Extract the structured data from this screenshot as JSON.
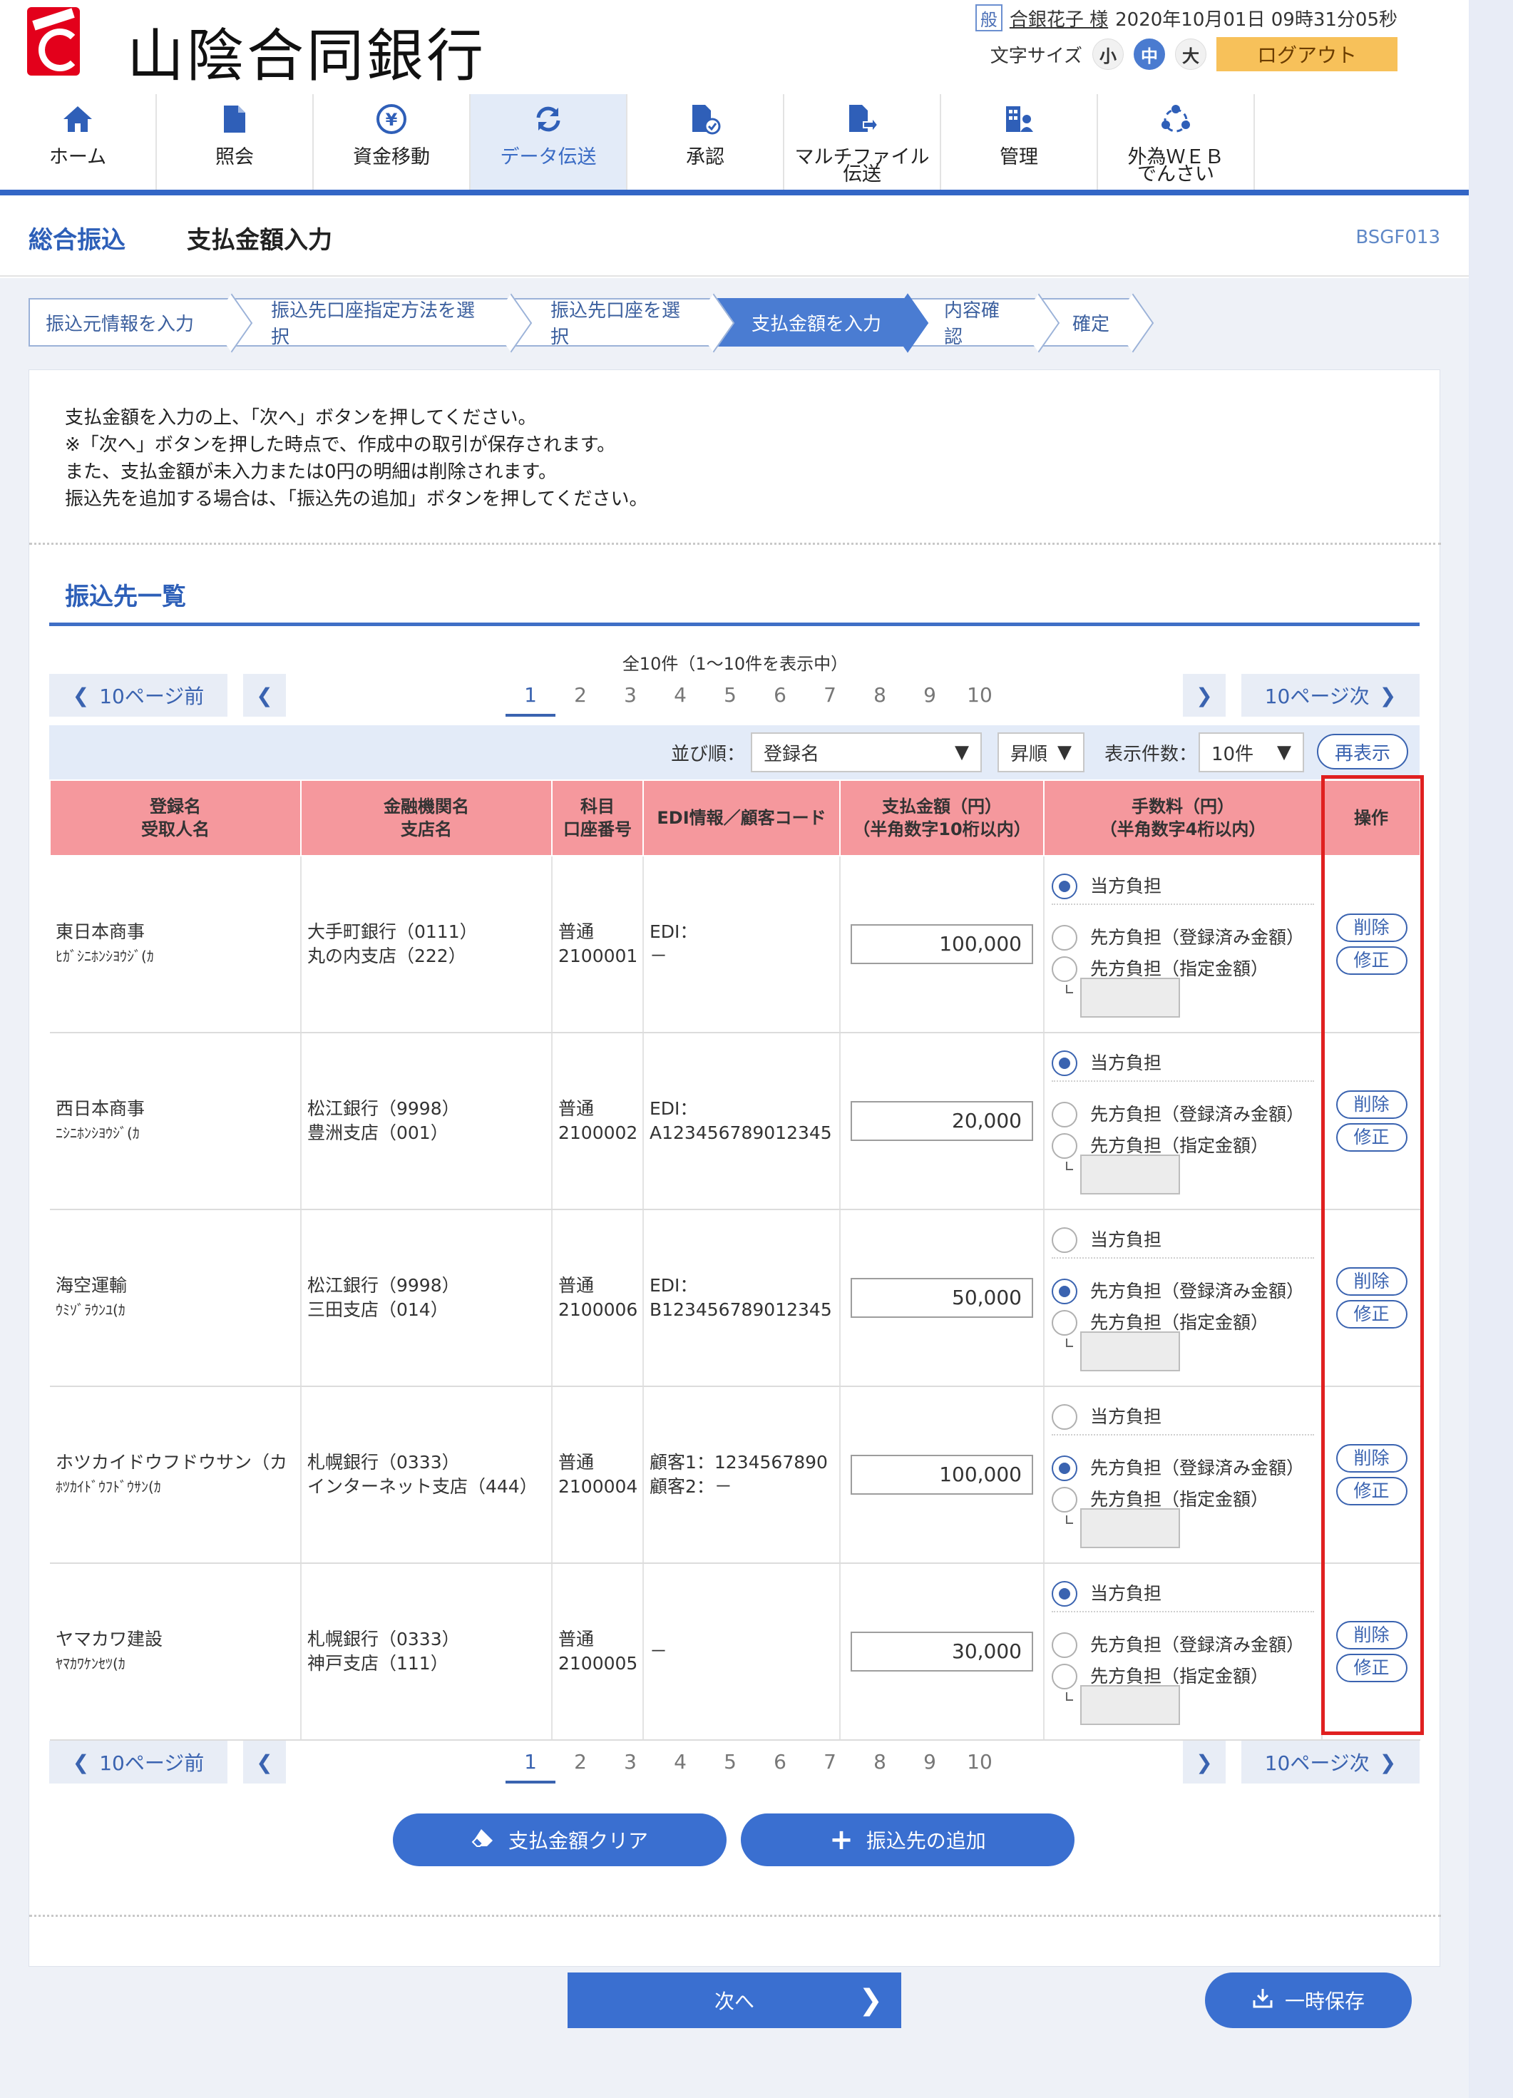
{
  "header": {
    "bank_name": "山陰合同銀行",
    "user_badge": "般",
    "user_name": "合銀花子 様",
    "datetime": "2020年10月01日 09時31分05秒",
    "font_size_label": "文字サイズ",
    "font_sizes": [
      "小",
      "中",
      "大"
    ],
    "logout": "ログアウト"
  },
  "nav": [
    {
      "label": "ホーム",
      "icon": "home-icon"
    },
    {
      "label": "照会",
      "icon": "document-icon"
    },
    {
      "label": "資金移動",
      "icon": "yen-transfer-icon"
    },
    {
      "label": "データ伝送",
      "icon": "refresh-icon"
    },
    {
      "label": "承認",
      "icon": "approve-icon"
    },
    {
      "label": "マルチファイル",
      "label2": "伝送",
      "icon": "file-send-icon"
    },
    {
      "label": "管理",
      "icon": "admin-icon"
    },
    {
      "label": "外為ＷＥＢ",
      "label2": "でんさい",
      "icon": "foreign-exchange-icon"
    }
  ],
  "title": {
    "category": "総合振込",
    "page": "支払金額入力",
    "code": "BSGF013"
  },
  "steps": [
    "振込元情報を入力",
    "振込先口座指定方法を選択",
    "振込先口座を選択",
    "支払金額を入力",
    "内容確認",
    "確定"
  ],
  "notes": [
    "支払金額を入力の上、「次へ」ボタンを押してください。",
    "※「次へ」ボタンを押した時点で、作成中の取引が保存されます。",
    "また、支払金額が未入力または0円の明細は削除されます。",
    "振込先を追加する場合は、「振込先の追加」ボタンを押してください。"
  ],
  "section_title": "振込先一覧",
  "count_text": "全10件（1～10件を表示中）",
  "pager": {
    "prev10": "10ページ前",
    "next10": "10ページ次",
    "pages": [
      "1",
      "2",
      "3",
      "4",
      "5",
      "6",
      "7",
      "8",
      "9",
      "10"
    ]
  },
  "controls": {
    "sort_label": "並び順：",
    "sort_value": "登録名",
    "order_value": "昇順",
    "display_label": "表示件数：",
    "display_value": "10件",
    "redisplay": "再表示"
  },
  "table": {
    "headers": {
      "name1": "登録名",
      "name2": "受取人名",
      "bank1": "金融機関名",
      "bank2": "支店名",
      "acct1": "科目",
      "acct2": "口座番号",
      "edi": "EDI情報／顧客コード",
      "amt1": "支払金額（円）",
      "amt2": "（半角数字10桁以内）",
      "fee1": "手数料（円）",
      "fee2": "（半角数字4桁以内）",
      "op": "操作"
    },
    "fee_options": [
      "当方負担",
      "先方負担（登録済み金額）",
      "先方負担（指定金額）"
    ],
    "delete_label": "削除",
    "edit_label": "修正",
    "rows": [
      {
        "name": "東日本商事",
        "kana": "ﾋｶﾞｼﾆﾎﾝｼﾖｳｼﾞ(ｶ",
        "bank": "大手町銀行（0111）",
        "branch": "丸の内支店（222）",
        "type": "普通",
        "acct": "2100001",
        "edi1": "EDI：",
        "edi2": "－",
        "amount": "100,000",
        "fee": 0
      },
      {
        "name": "西日本商事",
        "kana": "ﾆｼﾆﾎﾝｼﾖｳｼﾞ(ｶ",
        "bank": "松江銀行（9998）",
        "branch": "豊洲支店（001）",
        "type": "普通",
        "acct": "2100002",
        "edi1": "EDI：",
        "edi2": "A123456789012345",
        "amount": "20,000",
        "fee": 0
      },
      {
        "name": "海空運輸",
        "kana": "ｳﾐｿﾞﾗｳﾝﾕ(ｶ",
        "bank": "松江銀行（9998）",
        "branch": "三田支店（014）",
        "type": "普通",
        "acct": "2100006",
        "edi1": "EDI：",
        "edi2": "B123456789012345",
        "amount": "50,000",
        "fee": 1
      },
      {
        "name": "ホツカイドウフドウサン（カ",
        "kana": "ﾎﾂｶｲﾄﾞｳﾌﾄﾞｳｻﾝ(ｶ",
        "bank": "札幌銀行（0333）",
        "branch": "インターネット支店（444）",
        "type": "普通",
        "acct": "2100004",
        "edi1": "顧客1：1234567890",
        "edi2": "顧客2：－",
        "amount": "100,000",
        "fee": 1
      },
      {
        "name": "ヤマカワ建設",
        "kana": "ﾔﾏｶﾜｹﾝｾﾂ(ｶ",
        "bank": "札幌銀行（0333）",
        "branch": "神戸支店（111）",
        "type": "普通",
        "acct": "2100005",
        "edi1": "－",
        "edi2": "",
        "amount": "30,000",
        "fee": 0
      }
    ]
  },
  "buttons": {
    "clear": "支払金額クリア",
    "add": "振込先の追加",
    "next": "次へ",
    "save": "一時保存"
  }
}
